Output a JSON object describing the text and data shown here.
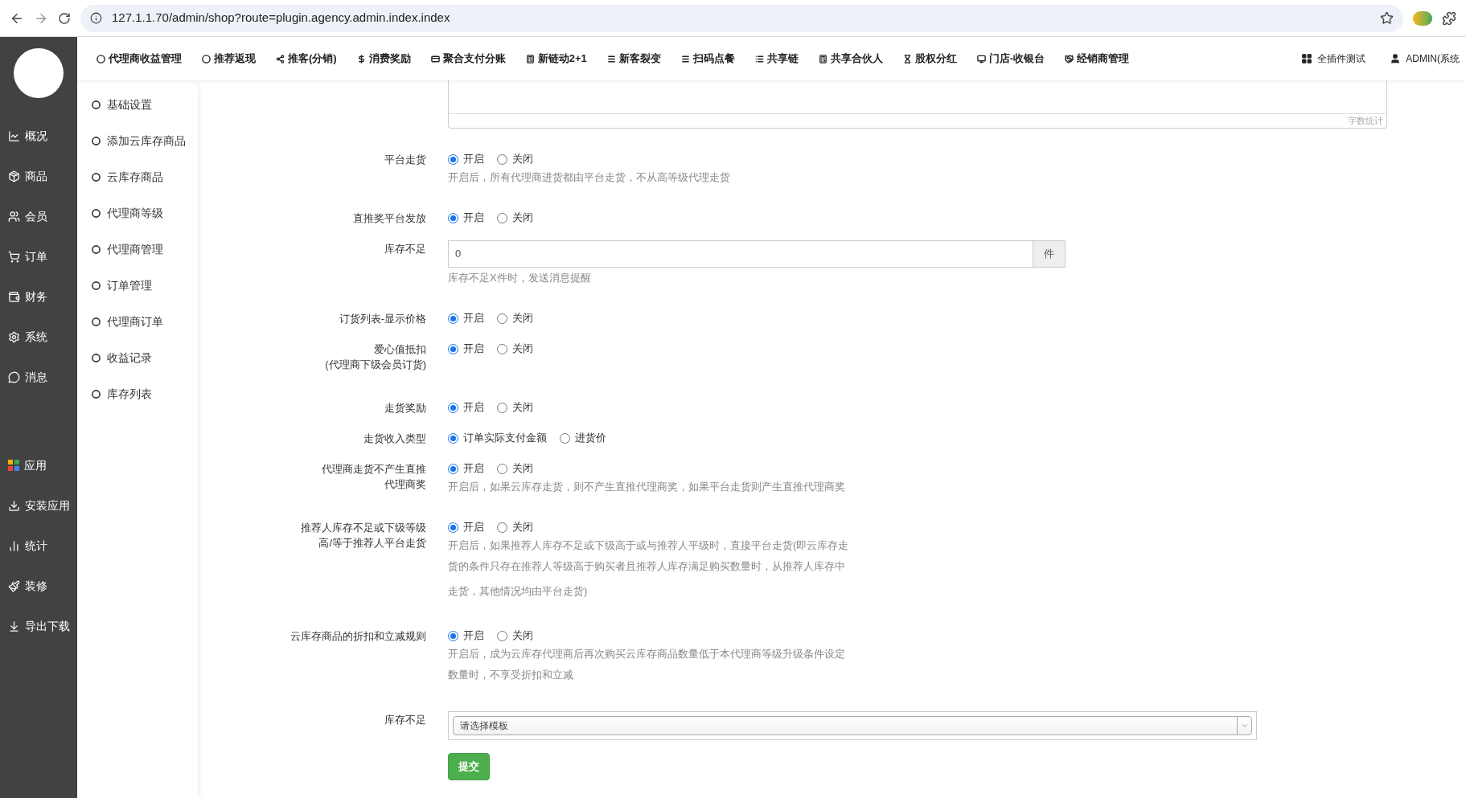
{
  "browser": {
    "url": "127.1.1.70/admin/shop?route=plugin.agency.admin.index.index"
  },
  "top_nav": {
    "items": [
      {
        "label": "代理商收益管理"
      },
      {
        "label": "推荐返现"
      },
      {
        "label": "推客(分销)"
      },
      {
        "label": "消费奖励"
      },
      {
        "label": "聚合支付分账"
      },
      {
        "label": "新链动2+1"
      },
      {
        "label": "新客裂变"
      },
      {
        "label": "扫码点餐"
      },
      {
        "label": "共享链"
      },
      {
        "label": "共享合伙人"
      },
      {
        "label": "股权分红"
      },
      {
        "label": "门店-收银台"
      },
      {
        "label": "经销商管理"
      }
    ],
    "right": [
      {
        "label": "全插件测试"
      },
      {
        "label": "ADMIN(系统"
      }
    ]
  },
  "sidebar": {
    "primary": [
      {
        "label": "概况"
      },
      {
        "label": "商品"
      },
      {
        "label": "会员"
      },
      {
        "label": "订单"
      },
      {
        "label": "财务"
      },
      {
        "label": "系统"
      },
      {
        "label": "消息"
      }
    ],
    "secondary": [
      {
        "label": "应用"
      },
      {
        "label": "安装应用"
      },
      {
        "label": "统计"
      },
      {
        "label": "装修"
      },
      {
        "label": "导出下载"
      }
    ]
  },
  "submenu": [
    {
      "label": "基础设置"
    },
    {
      "label": "添加云库存商品"
    },
    {
      "label": "云库存商品"
    },
    {
      "label": "代理商等级"
    },
    {
      "label": "代理商管理"
    },
    {
      "label": "订单管理"
    },
    {
      "label": "代理商订单"
    },
    {
      "label": "收益记录"
    },
    {
      "label": "库存列表"
    }
  ],
  "form": {
    "textarea": {
      "counter": "字数统计"
    },
    "fields": [
      {
        "kind": "radio",
        "label": [
          "平台走货"
        ],
        "options": [
          {
            "label": "开启",
            "selected": true
          },
          {
            "label": "关闭",
            "selected": false
          }
        ],
        "hint": [
          "开启后，所有代理商进货都由平台走货，不从高等级代理走货"
        ]
      },
      {
        "kind": "radio",
        "label": [
          "直推奖平台发放"
        ],
        "options": [
          {
            "label": "开启",
            "selected": true
          },
          {
            "label": "关闭",
            "selected": false
          }
        ]
      },
      {
        "kind": "input",
        "label": [
          "库存不足"
        ],
        "value": "0",
        "addon": "件",
        "hint": [
          "库存不足X件时，发送消息提醒"
        ]
      },
      {
        "kind": "radio",
        "label": [
          "订货列表-显示价格"
        ],
        "options": [
          {
            "label": "开启",
            "selected": true
          },
          {
            "label": "关闭",
            "selected": false
          }
        ]
      },
      {
        "kind": "radio",
        "label": [
          "爱心值抵扣",
          "(代理商下级会员订货)"
        ],
        "options": [
          {
            "label": "开启",
            "selected": true
          },
          {
            "label": "关闭",
            "selected": false
          }
        ]
      },
      {
        "kind": "radio",
        "label": [
          "走货奖励"
        ],
        "options": [
          {
            "label": "开启",
            "selected": true
          },
          {
            "label": "关闭",
            "selected": false
          }
        ]
      },
      {
        "kind": "radio",
        "label": [
          "走货收入类型"
        ],
        "options": [
          {
            "label": "订单实际支付金额",
            "selected": true
          },
          {
            "label": "进货价",
            "selected": false
          }
        ]
      },
      {
        "kind": "radio",
        "label": [
          "代理商走货不产生直推",
          "代理商奖"
        ],
        "options": [
          {
            "label": "开启",
            "selected": true
          },
          {
            "label": "关闭",
            "selected": false
          }
        ],
        "hint": [
          "开启后，如果云库存走货，则不产生直推代理商奖，如果平台走货则产生直推代理商奖"
        ]
      },
      {
        "kind": "radio",
        "label": [
          "推荐人库存不足或下级等级",
          "高/等于推荐人平台走货"
        ],
        "options": [
          {
            "label": "开启",
            "selected": true
          },
          {
            "label": "关闭",
            "selected": false
          }
        ],
        "hint": [
          "开启后，如果推荐人库存不足或下级高于或与推荐人平级时，直接平台走货(即云库存走",
          "货的条件只存在推荐人等级高于购买者且推荐人库存满足购买数量时，从推荐人库存中",
          "走货，其他情况均由平台走货)"
        ]
      },
      {
        "kind": "radio",
        "label": [
          "云库存商品的折扣和立减规则"
        ],
        "options": [
          {
            "label": "开启",
            "selected": true
          },
          {
            "label": "关闭",
            "selected": false
          }
        ],
        "hint": [
          "开启后，成为云库存代理商后再次购买云库存商品数量低于本代理商等级升级条件设定",
          "数量时，不享受折扣和立减"
        ]
      },
      {
        "kind": "select",
        "label": [
          "库存不足"
        ],
        "placeholder": "请选择模板"
      },
      {
        "kind": "submit",
        "button": "提交"
      }
    ]
  }
}
